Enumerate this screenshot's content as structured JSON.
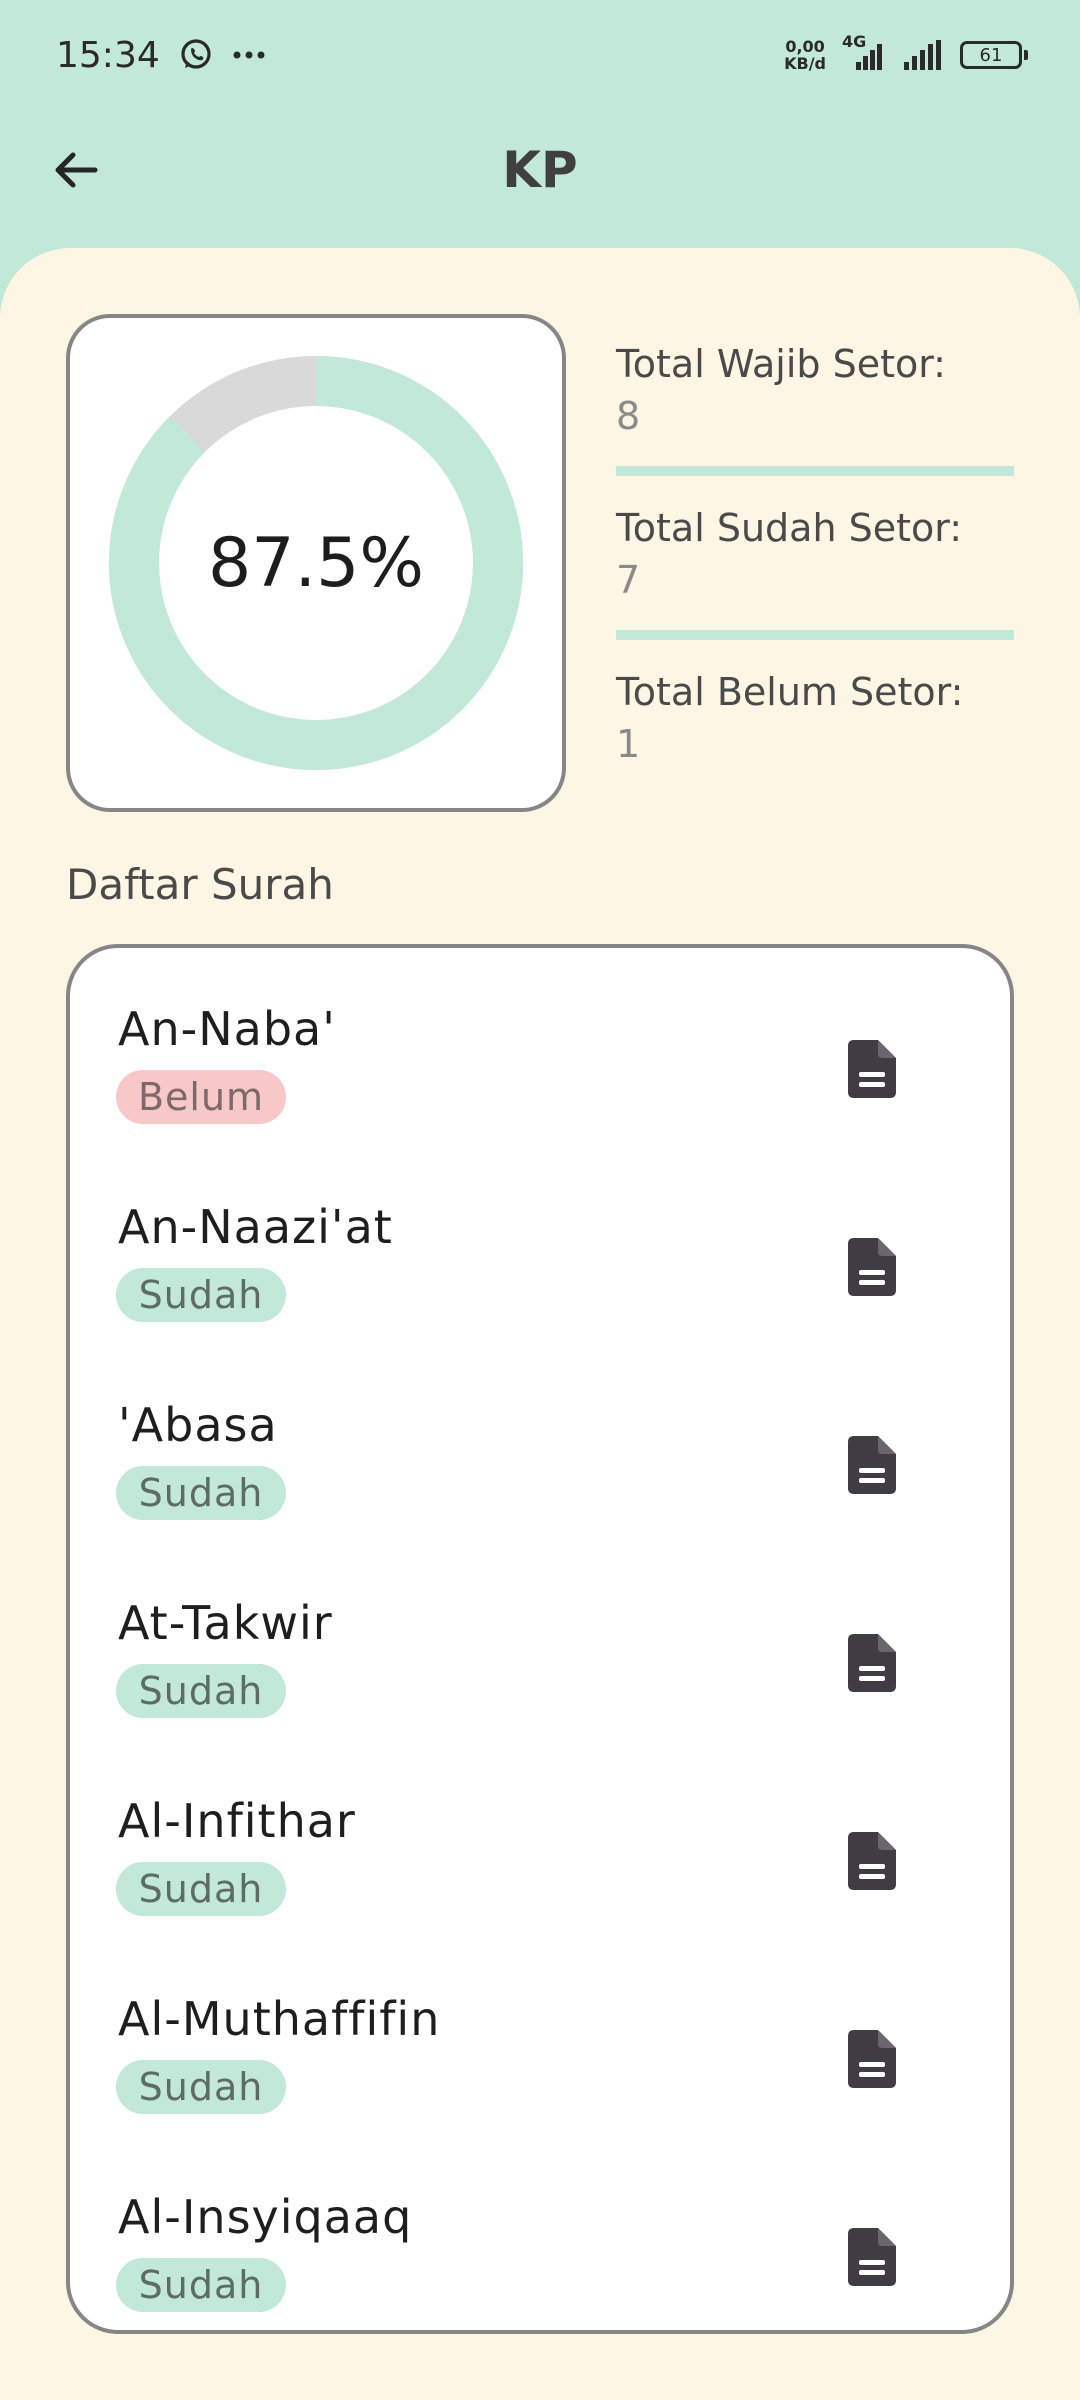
{
  "status_bar": {
    "time": "15:34",
    "net_speed_top": "0,00",
    "net_speed_bottom": "KB/d",
    "network_type": "4G",
    "battery": "61"
  },
  "app_bar": {
    "title": "KP"
  },
  "summary": {
    "percent_label": "87.5%",
    "percent_value": 0.875,
    "stats": [
      {
        "label": "Total Wajib Setor:",
        "value": "8"
      },
      {
        "label": "Total Sudah Setor:",
        "value": "7"
      },
      {
        "label": "Total Belum Setor:",
        "value": "1"
      }
    ]
  },
  "section_title": "Daftar Surah",
  "surah_list": [
    {
      "name": "An-Naba'",
      "status": "Belum"
    },
    {
      "name": "An-Naazi'at",
      "status": "Sudah"
    },
    {
      "name": "'Abasa",
      "status": "Sudah"
    },
    {
      "name": "At-Takwir",
      "status": "Sudah"
    },
    {
      "name": "Al-Infithar",
      "status": "Sudah"
    },
    {
      "name": "Al-Muthaffifin",
      "status": "Sudah"
    },
    {
      "name": "Al-Insyiqaaq",
      "status": "Sudah"
    }
  ],
  "colors": {
    "mint": "#c2e8d7",
    "cream": "#fdf6e4",
    "belum": "#f8c7c8",
    "donut_remaining": "#d9d9d9",
    "icon": "#3f3c44"
  }
}
